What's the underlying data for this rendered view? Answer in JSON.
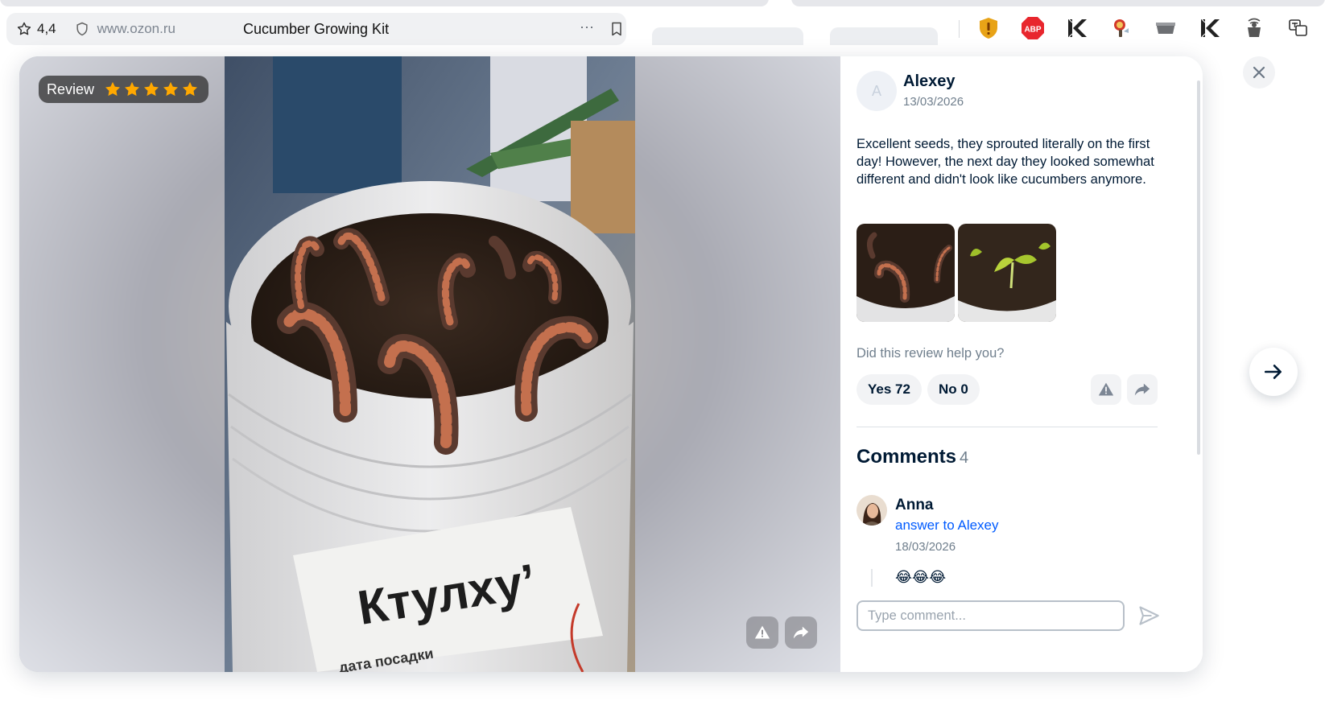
{
  "browser": {
    "page_rating": "4,4",
    "host": "www.ozon.ru",
    "page_title": "Cucumber Growing Kit",
    "more_glyph": "···",
    "extensions": [
      "warning-shield-icon",
      "adblock-icon",
      "k-logo-icon",
      "weather-icon",
      "tray-icon",
      "k-logo-icon",
      "broadcast-icon",
      "translate-icon"
    ],
    "adblock_label": "ABP"
  },
  "review": {
    "badge_label": "Review",
    "stars": 5,
    "star_color": "#ffa800",
    "author_initial": "A",
    "author": "Alexey",
    "date": "13/03/2026",
    "text": "Excellent seeds, they sprouted literally on the first day! However, the next day they looked somewhat different and didn't look like cucumbers anymore.",
    "photo_caption_main": "Ктулху’",
    "photo_caption_sub": "дата посадки",
    "helpful_question": "Did this review help you?",
    "yes_label": "Yes 72",
    "no_label": "No 0"
  },
  "comments": {
    "heading": "Comments",
    "count": "4",
    "items": [
      {
        "name": "Anna",
        "reply_to": "answer to Alexey",
        "date": "18/03/2026",
        "text": "😂😂😂"
      }
    ],
    "input_placeholder": "Type comment..."
  },
  "colors": {
    "accent": "#005bff",
    "text": "#001a34",
    "muted": "#707f8d"
  }
}
